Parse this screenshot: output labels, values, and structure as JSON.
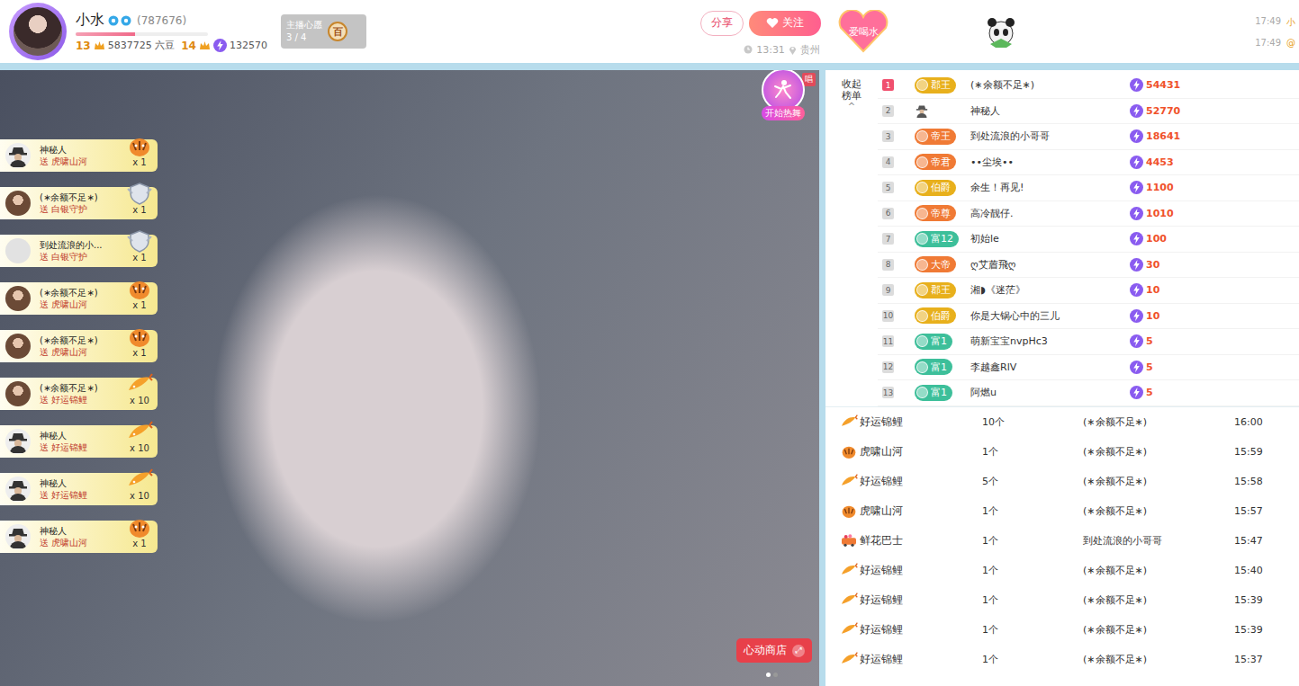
{
  "streamer": {
    "name": "小水",
    "id": "(787676)",
    "progress": 0.45,
    "level_left": "13",
    "beans": "5837725 六豆",
    "level_right": "14",
    "score": "132570"
  },
  "wish": {
    "title": "主播心愿",
    "count": "3 / 4",
    "badge": "百"
  },
  "actions": {
    "share": "分享",
    "follow": "关注",
    "time": "13:31",
    "location": "贵州"
  },
  "tag": "爱喝水",
  "chat_preview": [
    {
      "time": "17:49",
      "text": "小"
    },
    {
      "time": "17:49",
      "text": "@"
    }
  ],
  "video": {
    "corner_tag": "唱",
    "dance_button": "开始热舞",
    "shop_button": "心动商店",
    "shop_icon": "⤢",
    "pager": [
      {
        "selected": true
      },
      {
        "selected": false
      }
    ]
  },
  "gift_notices": [
    {
      "sender": "神秘人",
      "verb": "送",
      "gift": "虎啸山河",
      "count": "x 1",
      "avatar": "mystery",
      "kind": "tiger"
    },
    {
      "sender": "(∗余额不足∗)",
      "verb": "送",
      "gift": "白银守护",
      "count": "x 1",
      "avatar": "photo",
      "kind": "guard"
    },
    {
      "sender": "到处流浪的小...",
      "verb": "送",
      "gift": "白银守护",
      "count": "x 1",
      "avatar": "pale",
      "kind": "guard"
    },
    {
      "sender": "(∗余额不足∗)",
      "verb": "送",
      "gift": "虎啸山河",
      "count": "x 1",
      "avatar": "photo",
      "kind": "tiger"
    },
    {
      "sender": "(∗余额不足∗)",
      "verb": "送",
      "gift": "虎啸山河",
      "count": "x 1",
      "avatar": "photo",
      "kind": "tiger"
    },
    {
      "sender": "(∗余额不足∗)",
      "verb": "送",
      "gift": "好运锦鲤",
      "count": "x 10",
      "avatar": "photo",
      "kind": "koi"
    },
    {
      "sender": "神秘人",
      "verb": "送",
      "gift": "好运锦鲤",
      "count": "x 10",
      "avatar": "mystery",
      "kind": "koi"
    },
    {
      "sender": "神秘人",
      "verb": "送",
      "gift": "好运锦鲤",
      "count": "x 10",
      "avatar": "mystery",
      "kind": "koi"
    },
    {
      "sender": "神秘人",
      "verb": "送",
      "gift": "虎啸山河",
      "count": "x 1",
      "avatar": "mystery",
      "kind": "tiger"
    }
  ],
  "ranking": {
    "toggle": "收起榜单",
    "caret": "^",
    "rows": [
      {
        "rank": "1",
        "top": true,
        "kind": "badge",
        "badge": "郡王",
        "color": "#e8b01c",
        "name": "(∗余额不足∗)",
        "value": "54431"
      },
      {
        "rank": "2",
        "top": false,
        "kind": "mystery",
        "badge": "",
        "color": "#555555",
        "name": "神秘人",
        "value": "52770"
      },
      {
        "rank": "3",
        "top": false,
        "kind": "badge",
        "badge": "帝王",
        "color": "#f07a35",
        "name": "到处流浪的小哥哥",
        "value": "18641"
      },
      {
        "rank": "4",
        "top": false,
        "kind": "badge",
        "badge": "帝君",
        "color": "#f07a35",
        "name": "••尘埃••",
        "value": "4453"
      },
      {
        "rank": "5",
        "top": false,
        "kind": "badge",
        "badge": "伯爵",
        "color": "#e8b01c",
        "name": "余生！再见!",
        "value": "1100"
      },
      {
        "rank": "6",
        "top": false,
        "kind": "badge",
        "badge": "帝尊",
        "color": "#f07a35",
        "name": "高冷靓仔.",
        "value": "1010"
      },
      {
        "rank": "7",
        "top": false,
        "kind": "badge",
        "badge": "富12",
        "color": "#3dbf9a",
        "name": "初始le",
        "value": "100"
      },
      {
        "rank": "8",
        "top": false,
        "kind": "badge",
        "badge": "大帝",
        "color": "#f07a35",
        "name": "ღ艾葿飛ღ",
        "value": "30"
      },
      {
        "rank": "9",
        "top": false,
        "kind": "badge",
        "badge": "郡王",
        "color": "#e8b01c",
        "name": "湘◗《迷茫》",
        "value": "10"
      },
      {
        "rank": "10",
        "top": false,
        "kind": "badge",
        "badge": "伯爵",
        "color": "#e8b01c",
        "name": "你是大锅心中的三儿",
        "value": "10"
      },
      {
        "rank": "11",
        "top": false,
        "kind": "badge",
        "badge": "富1",
        "color": "#3dbf9a",
        "name": "萌新宝宝nvpHc3",
        "value": "5"
      },
      {
        "rank": "12",
        "top": false,
        "kind": "badge",
        "badge": "富1",
        "color": "#3dbf9a",
        "name": "李越鑫RlV",
        "value": "5"
      },
      {
        "rank": "13",
        "top": false,
        "kind": "badge",
        "badge": "富1",
        "color": "#3dbf9a",
        "name": "阿燃u",
        "value": "5"
      }
    ]
  },
  "gift_log": [
    {
      "gift": "好运锦鲤",
      "kind": "koi",
      "count": "10个",
      "sender": "(∗余额不足∗)",
      "time": "16:00"
    },
    {
      "gift": "虎啸山河",
      "kind": "tiger",
      "count": "1个",
      "sender": "(∗余额不足∗)",
      "time": "15:59"
    },
    {
      "gift": "好运锦鲤",
      "kind": "koi",
      "count": "5个",
      "sender": "(∗余额不足∗)",
      "time": "15:58"
    },
    {
      "gift": "虎啸山河",
      "kind": "tiger",
      "count": "1个",
      "sender": "(∗余额不足∗)",
      "time": "15:57"
    },
    {
      "gift": "鲜花巴士",
      "kind": "bus",
      "count": "1个",
      "sender": "到处流浪的小哥哥",
      "time": "15:47"
    },
    {
      "gift": "好运锦鲤",
      "kind": "koi",
      "count": "1个",
      "sender": "(∗余额不足∗)",
      "time": "15:40"
    },
    {
      "gift": "好运锦鲤",
      "kind": "koi",
      "count": "1个",
      "sender": "(∗余额不足∗)",
      "time": "15:39"
    },
    {
      "gift": "好运锦鲤",
      "kind": "koi",
      "count": "1个",
      "sender": "(∗余额不足∗)",
      "time": "15:39"
    },
    {
      "gift": "好运锦鲤",
      "kind": "koi",
      "count": "1个",
      "sender": "(∗余额不足∗)",
      "time": "15:37"
    }
  ]
}
